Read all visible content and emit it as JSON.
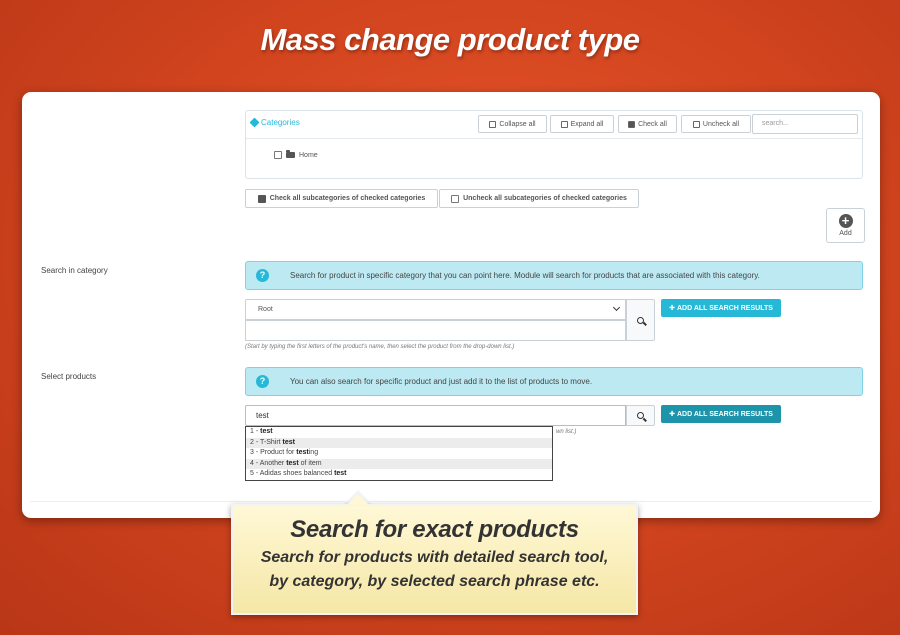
{
  "headline": "Mass change product type",
  "categories": {
    "title": "Categories",
    "collapse_label": "Collapse all",
    "expand_label": "Expand all",
    "check_label": "Check all",
    "uncheck_label": "Uncheck all",
    "search_placeholder": "search...",
    "node_label": "Home",
    "check_sub_label": "Check all subcategories of checked categories",
    "uncheck_sub_label": "Uncheck all subcategories of checked categories",
    "add_label": "Add"
  },
  "search_in_category": {
    "label": "Search in category",
    "info": "Search for product in specific category that you can point here. Module will search for products that are associated with this category.",
    "select_value": "Root",
    "add_all_label": "ADD ALL SEARCH RESULTS",
    "help": "(Start by typing the first letters of the product's name, then select the product from the drop-down list.)"
  },
  "select_products": {
    "label": "Select products",
    "info": "You can also search for specific product and just add it to the list of products to move.",
    "search_value": "test",
    "add_all_label": "ADD ALL SEARCH RESULTS",
    "help_tail": "wn list.)",
    "results": [
      {
        "prefix": "1 - ",
        "match": "test",
        "suffix": ""
      },
      {
        "prefix": "2 - T-Shirt ",
        "match": "test",
        "suffix": ""
      },
      {
        "prefix": "3 - Product for ",
        "match": "test",
        "suffix": "ing"
      },
      {
        "prefix": "4 - Another ",
        "match": "test",
        "suffix": " of item"
      },
      {
        "prefix": "5 - Adidas shoes balanced ",
        "match": "test",
        "suffix": ""
      }
    ]
  },
  "callout": {
    "title": "Search for exact products",
    "line1": "Search for products with detailed search tool,",
    "line2": "by category, by selected search phrase etc."
  },
  "colors": {
    "accent": "#25b9d7",
    "background": "#d4461f",
    "alert_bg": "#bdeaf2"
  }
}
